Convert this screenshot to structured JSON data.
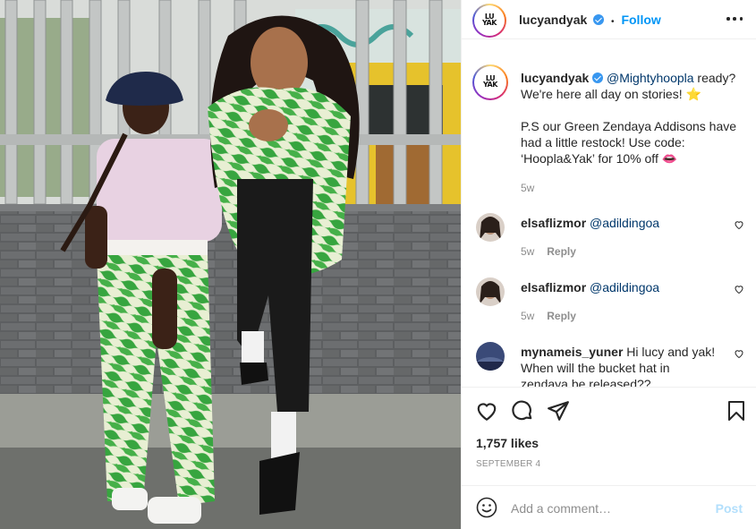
{
  "post": {
    "username": "lucyandyak",
    "follow_label": "Follow",
    "follow_separator": "•",
    "logo_line1": "LU",
    "logo_line2": "YAK"
  },
  "caption": {
    "username": "lucyandyak",
    "mention": "@Mightyhoopla",
    "text_1": " ready? We're here all day on stories! ",
    "emoji_1": "⭐",
    "text_2": "P.S our Green Zendaya Addisons have had a little restock! Use code: ‘Hoopla&Yak’ for 10% off ",
    "emoji_2": "👄",
    "time": "5w"
  },
  "comments": [
    {
      "username": "elsaflizmor",
      "mention": "@adildingoa",
      "text": "",
      "time": "5w",
      "reply_label": "Reply"
    },
    {
      "username": "elsaflizmor",
      "mention": "@adildingoa",
      "text": "",
      "time": "5w",
      "reply_label": "Reply"
    },
    {
      "username": "mynameis_yuner",
      "mention": "",
      "text": "Hi lucy and yak! When will the bucket hat in zendaya be released??",
      "time": "",
      "reply_label": ""
    }
  ],
  "actions": {
    "like_icon": "heart-icon",
    "comment_icon": "comment-icon",
    "share_icon": "share-icon",
    "save_icon": "bookmark-icon"
  },
  "likes": "1,757 likes",
  "date": "SEPTEMBER 4",
  "add_comment": {
    "placeholder": "Add a comment…",
    "post_label": "Post",
    "emoji_icon": "smiley-icon"
  },
  "colors": {
    "link_blue": "#0095f6",
    "verified": "#3897f0",
    "muted": "#8e8e8e",
    "post_disabled": "#b2dffc"
  }
}
